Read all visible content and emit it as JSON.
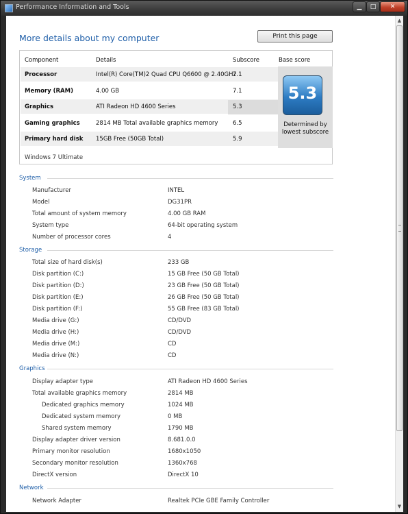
{
  "window": {
    "title": "Performance Information and Tools",
    "min_glyph": "▁",
    "max_glyph": "□",
    "close_glyph": "✕"
  },
  "heading": "More details about my computer",
  "print_button": "Print this page",
  "score_table": {
    "headers": [
      "Component",
      "Details",
      "Subscore",
      "Base score"
    ],
    "rows": [
      {
        "component": "Processor",
        "details": "Intel(R) Core(TM)2 Quad CPU Q6600 @ 2.40GHz",
        "subscore": "7.1"
      },
      {
        "component": "Memory (RAM)",
        "details": "4.00 GB",
        "subscore": "7.1"
      },
      {
        "component": "Graphics",
        "details": "ATI Radeon HD 4600 Series",
        "subscore": "5.3"
      },
      {
        "component": "Gaming graphics",
        "details": "2814 MB Total available graphics memory",
        "subscore": "6.5"
      },
      {
        "component": "Primary hard disk",
        "details": "15GB Free (50GB Total)",
        "subscore": "5.9"
      }
    ],
    "base_score": "5.3",
    "base_note_line1": "Determined by",
    "base_note_line2": "lowest subscore",
    "windows_version": "Windows 7 Ultimate"
  },
  "sections": {
    "system": {
      "title": "System",
      "items": [
        {
          "label": "Manufacturer",
          "value": "INTEL"
        },
        {
          "label": "Model",
          "value": "DG31PR"
        },
        {
          "label": "Total amount of system memory",
          "value": "4.00 GB RAM"
        },
        {
          "label": "System type",
          "value": "64-bit operating system"
        },
        {
          "label": "Number of processor cores",
          "value": "4"
        }
      ]
    },
    "storage": {
      "title": "Storage",
      "items": [
        {
          "label": "Total size of hard disk(s)",
          "value": "233 GB"
        },
        {
          "label": "Disk partition (C:)",
          "value": "15 GB Free (50 GB Total)"
        },
        {
          "label": "Disk partition (D:)",
          "value": "23 GB Free (50 GB Total)"
        },
        {
          "label": "Disk partition (E:)",
          "value": "26 GB Free (50 GB Total)"
        },
        {
          "label": "Disk partition (F:)",
          "value": "55 GB Free (83 GB Total)"
        },
        {
          "label": "Media drive (G:)",
          "value": "CD/DVD"
        },
        {
          "label": "Media drive (H:)",
          "value": "CD/DVD"
        },
        {
          "label": "Media drive (M:)",
          "value": "CD"
        },
        {
          "label": "Media drive (N:)",
          "value": "CD"
        }
      ]
    },
    "graphics": {
      "title": "Graphics",
      "items": [
        {
          "label": "Display adapter type",
          "value": "ATI Radeon HD 4600 Series"
        },
        {
          "label": "Total available graphics memory",
          "value": "2814 MB"
        },
        {
          "label": "Dedicated graphics memory",
          "value": "1024 MB"
        },
        {
          "label": "Dedicated system memory",
          "value": "0 MB"
        },
        {
          "label": "Shared system memory",
          "value": "1790 MB"
        },
        {
          "label": "Display adapter driver version",
          "value": "8.681.0.0"
        },
        {
          "label": "Primary monitor resolution",
          "value": "1680x1050"
        },
        {
          "label": "Secondary monitor resolution",
          "value": "1360x768"
        },
        {
          "label": "DirectX version",
          "value": "DirectX 10"
        }
      ]
    },
    "network": {
      "title": "Network",
      "items": [
        {
          "label": "Network Adapter",
          "value": "Realtek PCIe GBE Family Controller"
        }
      ]
    }
  },
  "scrollbar": {
    "up": "▲",
    "down": "▼"
  }
}
